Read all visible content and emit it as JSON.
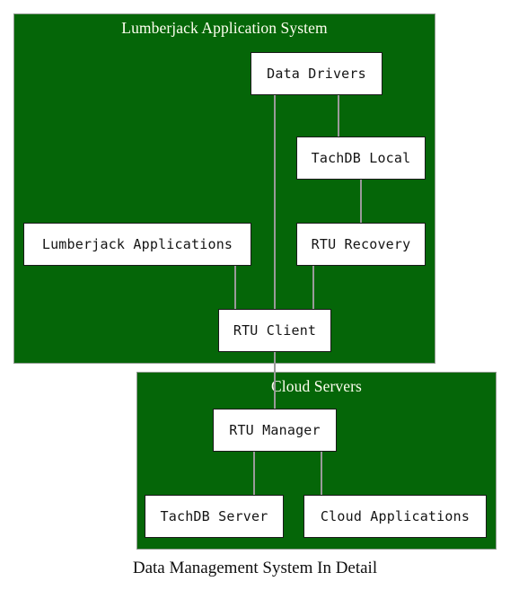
{
  "diagram": {
    "caption": "Data Management System In Detail",
    "colors": {
      "cluster_fill": "#056608",
      "cluster_border": "#8f9a8f",
      "node_fill": "#ffffff",
      "node_border": "#1a1a1a",
      "node_text": "#141414",
      "cluster_label_text": "#fffff0",
      "edge": "#9a9a9a",
      "caption_text": "#101010",
      "background": "#ffffff"
    },
    "clusters": [
      {
        "id": "lumberjack",
        "label": "Lumberjack Application System"
      },
      {
        "id": "cloud",
        "label": "Cloud Servers"
      }
    ],
    "nodes": [
      {
        "id": "data_drivers",
        "label": "Data Drivers",
        "cluster": "lumberjack"
      },
      {
        "id": "tachdb_local",
        "label": "TachDB Local",
        "cluster": "lumberjack"
      },
      {
        "id": "lumberjack_apps",
        "label": "Lumberjack Applications",
        "cluster": "lumberjack"
      },
      {
        "id": "rtu_recovery",
        "label": "RTU Recovery",
        "cluster": "lumberjack"
      },
      {
        "id": "rtu_client",
        "label": "RTU Client",
        "cluster": "lumberjack"
      },
      {
        "id": "rtu_manager",
        "label": "RTU Manager",
        "cluster": "cloud"
      },
      {
        "id": "tachdb_server",
        "label": "TachDB Server",
        "cluster": "cloud"
      },
      {
        "id": "cloud_apps",
        "label": "Cloud Applications",
        "cluster": "cloud"
      }
    ],
    "edges": [
      {
        "from": "data_drivers",
        "to": "tachdb_local"
      },
      {
        "from": "data_drivers",
        "to": "rtu_client"
      },
      {
        "from": "tachdb_local",
        "to": "rtu_recovery"
      },
      {
        "from": "lumberjack_apps",
        "to": "rtu_client"
      },
      {
        "from": "rtu_recovery",
        "to": "rtu_client"
      },
      {
        "from": "rtu_client",
        "to": "rtu_manager"
      },
      {
        "from": "rtu_manager",
        "to": "tachdb_server"
      },
      {
        "from": "rtu_manager",
        "to": "cloud_apps"
      }
    ]
  }
}
